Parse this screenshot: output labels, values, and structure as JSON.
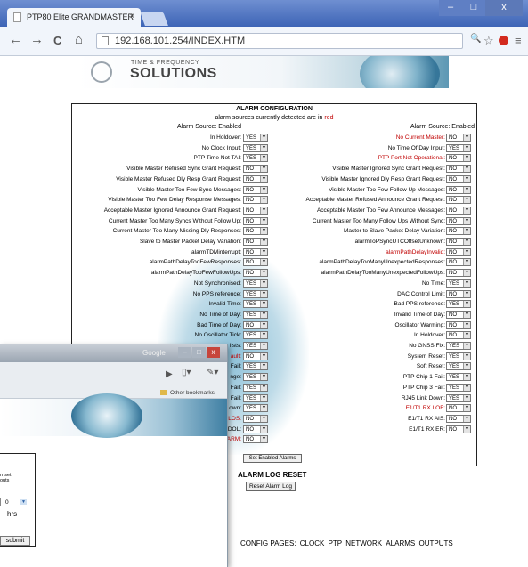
{
  "browser": {
    "tab_title": "PTP80 Elite GRANDMASTER",
    "tab_close": "×",
    "url": "192.168.101.254/INDEX.HTM",
    "nav_back": "←",
    "nav_forward": "→",
    "nav_reload": "C",
    "nav_home": "⌂",
    "win_min": "–",
    "win_max": "□",
    "win_close": "x",
    "zoom_glyph": "🔍",
    "star_glyph": "☆",
    "menu_glyph": "≡"
  },
  "logo": {
    "small": "TIME & FREQUENCY",
    "big": "SOLUTIONS"
  },
  "alarm": {
    "title": "ALARM CONFIGURATION",
    "subtitle_a": "alarm sources currently detected are in ",
    "subtitle_red": "red",
    "header_left": "Alarm Source: Enabled",
    "header_right": "Alarm Source: Enabled",
    "set_button": "Set Enabled Alarms",
    "left": [
      {
        "label": "In Holdover:",
        "value": "YES",
        "red": false
      },
      {
        "label": "No Clock Input:",
        "value": "YES",
        "red": false
      },
      {
        "label": "PTP Time Not TAI:",
        "value": "YES",
        "red": false
      },
      {
        "label": "Visible Master Refused Sync Grant Request:",
        "value": "NO",
        "red": false
      },
      {
        "label": "Visible Master Refused Dly Resp Grant Request:",
        "value": "NO",
        "red": false
      },
      {
        "label": "Visible Master Too Few Sync Messages:",
        "value": "NO",
        "red": false
      },
      {
        "label": "Visible Master Too Few Delay Response Messages:",
        "value": "NO",
        "red": false
      },
      {
        "label": "Acceptable Master Ignored Announce Grant Request:",
        "value": "NO",
        "red": false
      },
      {
        "label": "Current Master Too Many Syncs Without Follow Up:",
        "value": "NO",
        "red": false
      },
      {
        "label": "Current Master Too Many Missing Dly Responses:",
        "value": "NO",
        "red": false
      },
      {
        "label": "Slave to Master Packet Delay Variation:",
        "value": "NO",
        "red": false
      },
      {
        "label": "alarmTDMinterrupt:",
        "value": "NO",
        "red": false
      },
      {
        "label": "alarmPathDelayTooFewResponses:",
        "value": "NO",
        "red": false
      },
      {
        "label": "alarmPathDelayTooFewFollowUps:",
        "value": "NO",
        "red": false
      },
      {
        "label": "Not Synchronised:",
        "value": "YES",
        "red": false
      },
      {
        "label": "No PPS reference:",
        "value": "YES",
        "red": false
      },
      {
        "label": "Invalid Time:",
        "value": "YES",
        "red": false
      },
      {
        "label": "No Time of Day:",
        "value": "YES",
        "red": false
      },
      {
        "label": "Bad Time of Day:",
        "value": "NO",
        "red": false
      },
      {
        "label": "No Oscillator Tick:",
        "value": "YES",
        "red": false
      },
      {
        "label": "lists:",
        "value": "YES",
        "red": false
      },
      {
        "label": "ault:",
        "value": "NO",
        "red": true
      },
      {
        "label": "Fail:",
        "value": "YES",
        "red": false
      },
      {
        "label": "nge:",
        "value": "YES",
        "red": false
      },
      {
        "label": "Fail:",
        "value": "YES",
        "red": false
      },
      {
        "label": "Fail:",
        "value": "YES",
        "red": false
      },
      {
        "label": "own:",
        "value": "YES",
        "red": false
      },
      {
        "label": "LOS:",
        "value": "NO",
        "red": true
      },
      {
        "label": "DOL:",
        "value": "NO",
        "red": false
      },
      {
        "label": "ARM:",
        "value": "NO",
        "red": true
      }
    ],
    "right": [
      {
        "label": "No Current Master:",
        "value": "NO",
        "red": true
      },
      {
        "label": "No Time Of Day Input:",
        "value": "YES",
        "red": false
      },
      {
        "label": "PTP Port Not Operational:",
        "value": "NO",
        "red": true
      },
      {
        "label": "Visible Master Ignored Sync Grant Request:",
        "value": "NO",
        "red": false
      },
      {
        "label": "Visible Master Ignored Dly Resp Grant Request:",
        "value": "NO",
        "red": false
      },
      {
        "label": "Visible Master Too Few Follow Up Messages:",
        "value": "NO",
        "red": false
      },
      {
        "label": "Acceptable Master Refused Announce Grant Request:",
        "value": "NO",
        "red": false
      },
      {
        "label": "Acceptable Master Too Few Announce Messages:",
        "value": "NO",
        "red": false
      },
      {
        "label": "Current Master Too Many Follow Ups Without Sync:",
        "value": "NO",
        "red": false
      },
      {
        "label": "Master to Slave Packet Delay Variation:",
        "value": "NO",
        "red": false
      },
      {
        "label": "alarmToPSyncUTCOffsetUnknown:",
        "value": "NO",
        "red": false
      },
      {
        "label": "alarmPathDelayInvalid:",
        "value": "NO",
        "red": true
      },
      {
        "label": "alarmPathDelayTooManyUnexpectedResponses:",
        "value": "NO",
        "red": false
      },
      {
        "label": "alarmPathDelayTooManyUnexpectedFollowUps:",
        "value": "NO",
        "red": false
      },
      {
        "label": "No Time:",
        "value": "YES",
        "red": false
      },
      {
        "label": "DAC Control Limit:",
        "value": "NO",
        "red": false
      },
      {
        "label": "Bad PPS reference:",
        "value": "YES",
        "red": false
      },
      {
        "label": "Invalid Time of Day:",
        "value": "NO",
        "red": false
      },
      {
        "label": "Oscillator Warming:",
        "value": "NO",
        "red": false
      },
      {
        "label": "In Holdover:",
        "value": "NO",
        "red": false
      },
      {
        "label": "No GNSS Fix:",
        "value": "YES",
        "red": false
      },
      {
        "label": "System Reset:",
        "value": "YES",
        "red": false
      },
      {
        "label": "Soft Reset:",
        "value": "YES",
        "red": false
      },
      {
        "label": "PTP Chip 1 Fail:",
        "value": "YES",
        "red": false
      },
      {
        "label": "PTP Chip 3 Fail:",
        "value": "YES",
        "red": false
      },
      {
        "label": "RJ45 Link Down:",
        "value": "YES",
        "red": false
      },
      {
        "label": "E1/T1 RX LOF:",
        "value": "NO",
        "red": true
      },
      {
        "label": "E1/T1 RX AIS:",
        "value": "NO",
        "red": false
      },
      {
        "label": "E1/T1 RX ER:",
        "value": "NO",
        "red": false
      }
    ]
  },
  "reset": {
    "title": "ALARM LOG RESET",
    "button": "Reset Alarm Log"
  },
  "config": {
    "label": "CONFIG PAGES:",
    "links": [
      "CLOCK",
      "PTP",
      "NETWORK",
      "ALARMS",
      "OUTPUTS"
    ]
  },
  "back_window": {
    "google": "Google",
    "bookmarks": "Other bookmarks",
    "text_lines": [
      "rrtset",
      "outs"
    ],
    "dropdown_value": "0",
    "hrs": "hrs",
    "submit": "submit",
    "close": "x"
  }
}
